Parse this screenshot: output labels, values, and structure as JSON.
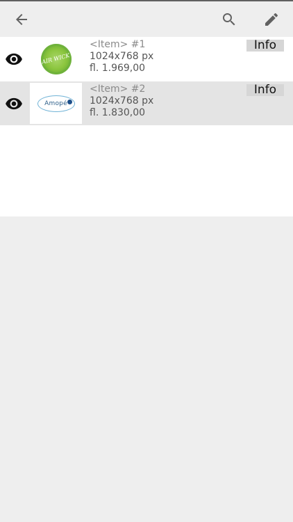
{
  "toolbar": {
    "back_icon": "arrow-left-icon",
    "search_icon": "search-icon",
    "edit_icon": "pencil-icon"
  },
  "items": [
    {
      "name": "<Item> #1",
      "size": "1024x768 px",
      "price": "fl. 1.969,00",
      "info_label": "Info",
      "logo_text": "AIR WICK"
    },
    {
      "name": "<Item> #2",
      "size": "1024x768 px",
      "price": "fl. 1.830,00",
      "info_label": "Info",
      "logo_text": "Amopé"
    }
  ]
}
